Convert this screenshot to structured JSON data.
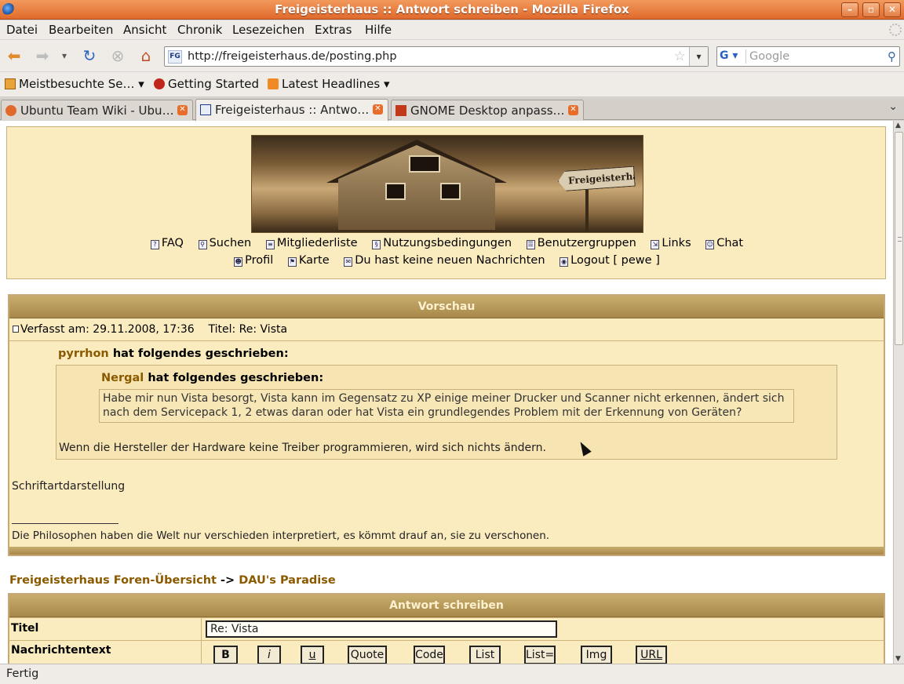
{
  "window": {
    "title": "Freigeisterhaus :: Antwort schreiben - Mozilla Firefox"
  },
  "menu": [
    "Datei",
    "Bearbeiten",
    "Ansicht",
    "Chronik",
    "Lesezeichen",
    "Extras",
    "Hilfe"
  ],
  "nav": {
    "url": "http://freigeisterhaus.de/posting.php",
    "search_placeholder": "Google"
  },
  "bookmarks": [
    "Meistbesuchte Se…",
    "Getting Started",
    "Latest Headlines"
  ],
  "tabs": [
    {
      "label": "Ubuntu Team Wiki - Ubu…"
    },
    {
      "label": "Freigeisterhaus :: Antwo…"
    },
    {
      "label": "GNOME Desktop anpass…"
    }
  ],
  "header": {
    "banner_sign": "Freigeisterhaus",
    "links_row1": [
      "FAQ",
      "Suchen",
      "Mitgliederliste",
      "Nutzungsbedingungen",
      "Benutzergruppen",
      "Links",
      "Chat"
    ],
    "links_row2": [
      "Profil",
      "Karte",
      "Du hast keine neuen Nachrichten",
      "Logout [ pewe ]"
    ]
  },
  "preview": {
    "heading": "Vorschau",
    "meta": "Verfasst am: 29.11.2008, 17:36    Titel: Re: Vista",
    "quote1_user": "pyrrhon",
    "quote2_user": "Nergal",
    "wrote": "hat folgendes geschrieben:",
    "inner_quote_line1": "Habe mir nun Vista besorgt, Vista kann im Gegensatz zu XP einige meiner Drucker und Scanner nicht erkennen, ändert sich",
    "inner_quote_line2": "nach dem Servicepack 1, 2 etwas daran oder hat Vista ein grundlegendes Problem mit der Erkennung von Geräten?",
    "reply_text": "Wenn die Hersteller der Hardware keine Treiber programmieren, wird sich nichts ändern.",
    "font_note": "Schriftartdarstellung",
    "signature": "Die Philosophen haben die Welt nur verschieden interpretiert, es kömmt drauf an, sie zu verschonen."
  },
  "breadcrumb": {
    "home": "Freigeisterhaus Foren-Übersicht",
    "sep": " -> ",
    "forum": "DAU's Paradise"
  },
  "reply": {
    "heading": "Antwort schreiben",
    "title_label": "Titel",
    "title_value": "Re: Vista",
    "message_label": "Nachrichtentext",
    "format_buttons": [
      "B",
      "i",
      "u",
      "Quote",
      "Code",
      "List",
      "List=",
      "Img",
      "URL"
    ]
  },
  "status": {
    "text": "Fertig"
  },
  "colors": {
    "titlebar": "#e06a2c",
    "forum_bg": "#fbecc0",
    "forum_header": "#a8884a",
    "link": "#8b5a00"
  }
}
